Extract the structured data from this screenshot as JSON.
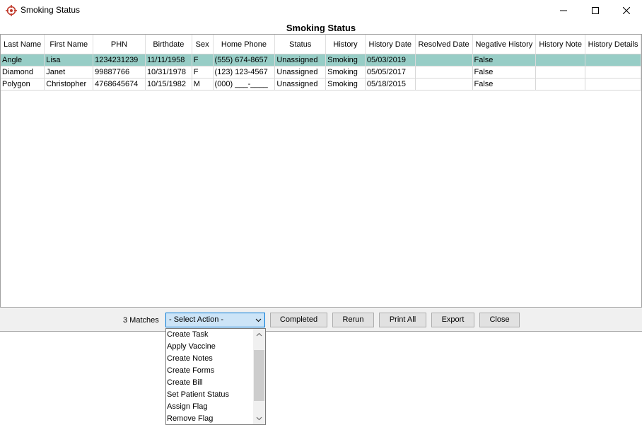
{
  "window": {
    "title": "Smoking Status",
    "icon": "crosshair-target-icon"
  },
  "panel": {
    "title": "Smoking Status"
  },
  "grid": {
    "columns": [
      "Last Name",
      "First Name",
      "PHN",
      "Birthdate",
      "Sex",
      "Home Phone",
      "Status",
      "History",
      "History Date",
      "Resolved Date",
      "Negative History",
      "History Note",
      "History Details"
    ],
    "rows": [
      [
        "Angle",
        "Lisa",
        "1234231239",
        "11/11/1958",
        "F",
        "(555) 674-8657",
        "Unassigned",
        "Smoking",
        "05/03/2019",
        "",
        "False",
        "",
        ""
      ],
      [
        "Diamond",
        "Janet",
        "99887766",
        "10/31/1978",
        "F",
        "(123) 123-4567",
        "Unassigned",
        "Smoking",
        "05/05/2017",
        "",
        "False",
        "",
        ""
      ],
      [
        "Polygon",
        "Christopher",
        "4768645674",
        "10/15/1982",
        "M",
        "(000) ___-____",
        "Unassigned",
        "Smoking",
        "05/18/2015",
        "",
        "False",
        "",
        ""
      ]
    ],
    "selected_row": 0
  },
  "footer": {
    "matches": "3 Matches",
    "action_select": "- Select Action -",
    "buttons": {
      "completed": "Completed",
      "rerun": "Rerun",
      "print_all": "Print All",
      "export": "Export",
      "close": "Close"
    }
  },
  "dropdown": {
    "items": [
      "Create Task",
      "Apply Vaccine",
      "Create Notes",
      "Create Forms",
      "Create Bill",
      "Set Patient Status",
      "Assign Flag",
      "Remove Flag"
    ]
  },
  "colors": {
    "selected_row": "#97cdc6",
    "select_focus": "#cce4f7",
    "select_border": "#0078d7"
  }
}
